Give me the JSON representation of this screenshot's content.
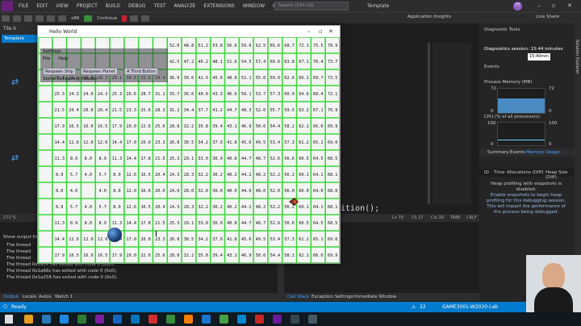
{
  "menubar": {
    "items": [
      "FILE",
      "EDIT",
      "VIEW",
      "PROJECT",
      "BUILD",
      "DEBUG",
      "TEST",
      "ANALYZE",
      "EXTENSIONS",
      "WINDOW",
      "HELP"
    ],
    "search_placeholder": "Search (Ctrl+Q)",
    "solution_name": "Template",
    "avatar_initials": "TT"
  },
  "toolbar": {
    "continue_label": "Continue",
    "config": "x86",
    "app_insights": "Application Insights",
    "live_share": "Live Share"
  },
  "editor": {
    "tab_label": "Template",
    "file_tab": "Tile.h",
    "code_visible": "ition();",
    "status": {
      "ln": "Ln 70",
      "ch": "Ch 27",
      "col": "Col 30",
      "tabs": "TABS",
      "eol": "CRLF",
      "zoom": "173 %"
    }
  },
  "output": {
    "header": "Show output from:",
    "lines": [
      "The thread",
      "The thread",
      "The thread",
      "The thread 0x39c4 has exited with code 0 (0x0).",
      "The thread 0x1a66c has exited with code 0 (0x0).",
      "The thread 0x1a258 has exited with code 0 (0x0)."
    ]
  },
  "bottom_tabs": [
    "Output",
    "Locals",
    "Autos",
    "Watch 1",
    "Call Stack",
    "Exception Settings",
    "Immediate Window"
  ],
  "statusbar": {
    "ready": "Ready",
    "project": "GAME3001-W2020-Lab",
    "errors": "22"
  },
  "diagnostics": {
    "title": "Diagnostic Tools",
    "session": "Diagnostics session: 15:44 minutes",
    "time_box": "15:40min",
    "events_label": "Events",
    "memory_label": "Process Memory (MB)",
    "mem_max": "72",
    "mem_min": "0",
    "cpu_label": "CPU (% of all processors)",
    "cpu_max": "100",
    "cpu_min": "0",
    "tabs": [
      "Summary",
      "Events",
      "Memory Usage"
    ],
    "subtabs": [
      "ID",
      "Time",
      "Allocations (Diff)",
      "Heap Size (Diff)"
    ],
    "warning": "Heap profiling with snapshots is disabled.",
    "warning_link": "Enable snapshots to begin heap profiling for this debugging session. This will impact the performance of the process being debugged.",
    "side_label": "Solution Explorer",
    "memory_fill_percent": 60
  },
  "app": {
    "title": "Hello World",
    "settings_header": "Settings",
    "menu": [
      "File",
      "Help"
    ],
    "buttons": [
      "Respawn Ship",
      "Respawn Planet",
      "A Third Button"
    ],
    "collapsing_header": "Some Collapsing Header",
    "grid_rows": [
      [
        "",
        "",
        "",
        "",
        "",
        "",
        "",
        "",
        "",
        "52.0",
        "48.8",
        "51.2",
        "53.8",
        "56.6",
        "59.6",
        "62.5",
        "65.6",
        "68.7",
        "72.1",
        "75.5",
        "78.9"
      ],
      [
        "",
        "",
        "",
        "",
        "",
        "",
        "",
        "",
        "",
        "42.5",
        "47.2",
        "46.2",
        "48.1",
        "51.6",
        "54.5",
        "57.4",
        "60.6",
        "63.8",
        "67.1",
        "70.4",
        "73.7"
      ],
      [
        "29.1",
        "28.3",
        "28.0",
        "28.3",
        "29.1",
        "30.5",
        "32.3",
        "34.4",
        "36.9",
        "39.6",
        "42.5",
        "45.6",
        "48.8",
        "52.1",
        "55.6",
        "59.0",
        "62.6",
        "66.1",
        "69.7",
        "73.5"
      ],
      [
        "25.3",
        "24.3",
        "24.0",
        "24.3",
        "25.3",
        "26.6",
        "28.7",
        "31.1",
        "33.7",
        "36.6",
        "40.0",
        "43.3",
        "46.6",
        "50.1",
        "53.7",
        "57.3",
        "60.9",
        "64.6",
        "68.4",
        "72.1"
      ],
      [
        "21.5",
        "20.4",
        "20.0",
        "20.4",
        "21.5",
        "23.3",
        "25.6",
        "28.3",
        "31.2",
        "34.4",
        "37.7",
        "41.2",
        "44.7",
        "48.3",
        "52.0",
        "55.7",
        "59.5",
        "63.2",
        "67.1",
        "70.9"
      ],
      [
        "17.9",
        "16.5",
        "16.0",
        "16.5",
        "17.9",
        "20.0",
        "22.6",
        "25.6",
        "28.8",
        "32.2",
        "35.8",
        "39.4",
        "43.1",
        "46.9",
        "50.6",
        "54.4",
        "58.2",
        "62.1",
        "66.0",
        "69.9"
      ],
      [
        "14.4",
        "12.6",
        "12.0",
        "12.6",
        "14.4",
        "17.0",
        "20.0",
        "23.3",
        "26.8",
        "30.5",
        "34.2",
        "37.9",
        "41.8",
        "45.6",
        "49.5",
        "53.4",
        "57.3",
        "61.2",
        "65.1",
        "69.0"
      ],
      [
        "11.3",
        "8.9",
        "8.0",
        "8.9",
        "11.3",
        "14.4",
        "17.8",
        "21.5",
        "25.3",
        "29.1",
        "33.0",
        "36.9",
        "40.8",
        "44.7",
        "48.7",
        "52.6",
        "56.6",
        "60.5",
        "64.5",
        "68.5"
      ],
      [
        "8.9",
        "5.7",
        "4.0",
        "5.7",
        "8.9",
        "12.6",
        "16.5",
        "20.4",
        "24.3",
        "28.3",
        "32.2",
        "36.2",
        "40.2",
        "44.2",
        "48.2",
        "52.2",
        "56.2",
        "60.1",
        "64.1",
        "68.1"
      ],
      [
        "8.0",
        "4.0",
        "",
        "4.0",
        "8.0",
        "12.0",
        "16.0",
        "20.0",
        "24.0",
        "28.0",
        "32.0",
        "36.0",
        "40.0",
        "44.0",
        "48.0",
        "52.0",
        "56.0",
        "60.0",
        "64.0",
        "68.0"
      ],
      [
        "8.9",
        "5.7",
        "4.0",
        "5.7",
        "8.9",
        "12.6",
        "16.5",
        "20.4",
        "24.3",
        "28.3",
        "32.2",
        "36.2",
        "40.2",
        "44.2",
        "48.2",
        "52.2",
        "56.2",
        "60.1",
        "64.1",
        "68.1"
      ],
      [
        "11.3",
        "8.9",
        "8.0",
        "8.9",
        "11.3",
        "14.4",
        "17.8",
        "21.5",
        "25.3",
        "29.1",
        "33.0",
        "36.9",
        "40.8",
        "44.7",
        "48.7",
        "52.6",
        "56.6",
        "60.5",
        "64.5",
        "68.5"
      ],
      [
        "14.4",
        "12.6",
        "12.0",
        "12.6",
        "14.4",
        "17.0",
        "20.0",
        "23.3",
        "26.8",
        "30.5",
        "34.2",
        "37.9",
        "41.8",
        "45.6",
        "49.5",
        "53.4",
        "57.3",
        "61.2",
        "65.1",
        "69.0"
      ],
      [
        "17.9",
        "16.5",
        "16.0",
        "16.5",
        "17.9",
        "20.0",
        "22.6",
        "25.6",
        "28.8",
        "32.2",
        "35.8",
        "39.4",
        "43.1",
        "46.9",
        "50.6",
        "54.4",
        "58.2",
        "62.1",
        "66.0",
        "69.9"
      ]
    ]
  },
  "colors": {
    "accent": "#007acc",
    "grid_line": "#3ad83a",
    "vs_purple": "#68217a"
  }
}
